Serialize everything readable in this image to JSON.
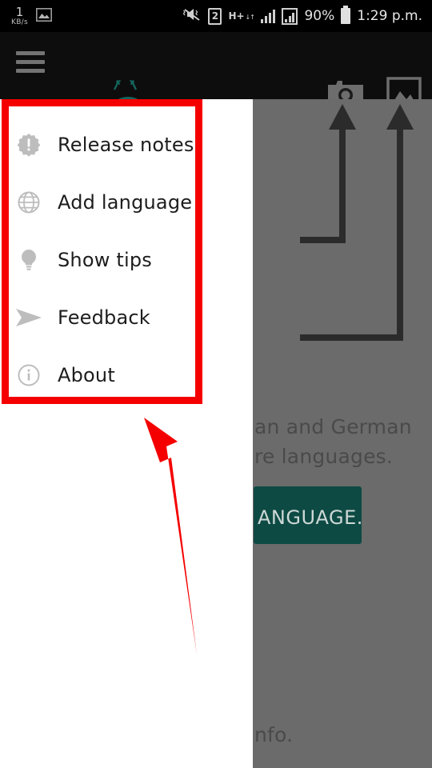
{
  "statusbar": {
    "network_speed_value": "1",
    "network_speed_unit": "KB/s",
    "gallery_icon": "image-icon",
    "mute_icon": "vibrate-mute-icon",
    "sim_badge": "2",
    "network_type": "H+",
    "network_arrows": "↓↑",
    "signal_icon": "signal-bars-icon",
    "signal_boxed_icon": "signal-boxed-icon",
    "battery_percent": "90%",
    "battery_icon": "battery-full-icon",
    "clock": "1:29 p.m."
  },
  "toolbar": {
    "menu_icon": "hamburger-menu-icon",
    "logo": "android-mascot-glasses-logo",
    "camera_icon": "camera-icon",
    "gallery_icon": "gallery-icon"
  },
  "drawer": {
    "items": [
      {
        "label": "Release notes",
        "icon": "badge-exclamation-icon"
      },
      {
        "label": "Add language",
        "icon": "globe-icon"
      },
      {
        "label": "Show tips",
        "icon": "lightbulb-icon"
      },
      {
        "label": "Feedback",
        "icon": "send-arrow-icon"
      },
      {
        "label": "About",
        "icon": "info-circle-icon"
      }
    ]
  },
  "background": {
    "line1": "an and German",
    "line2": "re languages.",
    "button_label": "ANGUAGE.",
    "line3": "nfo.",
    "tutorial_arrows": "two-up-arrows-pointing-to-toolbar-icons"
  },
  "annotation": {
    "box": "red-highlight-box-around-menu-items",
    "arrow": "red-pointer-arrow",
    "color": "#f40000"
  },
  "colors": {
    "drawer_bg": "#ffffff",
    "scrim": "#6b6b6b",
    "toolbar_bg": "#0d0d0d",
    "statusbar_bg": "#000000",
    "accent_teal": "#0e4a44",
    "icon_gray": "#bdbdbd",
    "text_primary": "#1d1d1d"
  }
}
